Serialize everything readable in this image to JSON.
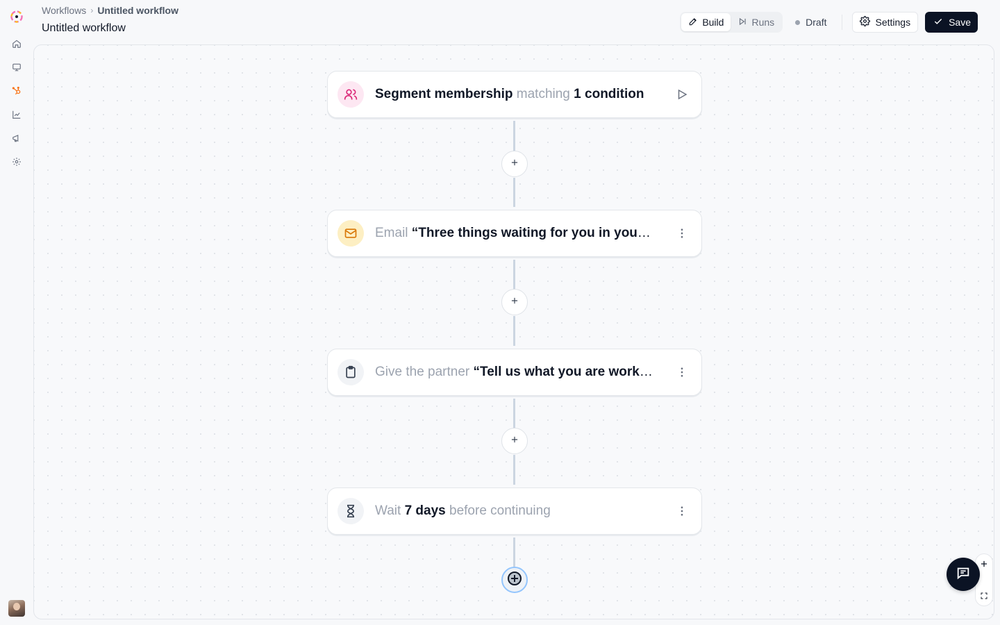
{
  "breadcrumb": {
    "root": "Workflows",
    "separator": "›",
    "current": "Untitled workflow"
  },
  "page": {
    "title": "Untitled workflow"
  },
  "toolbar": {
    "build_label": "Build",
    "runs_label": "Runs",
    "status_label": "Draft",
    "settings_label": "Settings",
    "save_label": "Save"
  },
  "nav": {
    "items": [
      "home-icon",
      "monitor-icon",
      "hubspot-icon",
      "chart-icon",
      "megaphone-icon",
      "gear-icon"
    ],
    "active": "hubspot-icon"
  },
  "workflow": {
    "trigger": {
      "title": "Segment membership",
      "connector": "matching",
      "condition": "1 condition"
    },
    "steps": [
      {
        "type": "Email",
        "value": "“Three things waiting for you in your account”"
      },
      {
        "type": "Give the partner",
        "value": "“Tell us what you are working on” form"
      },
      {
        "prefix": "Wait",
        "value": "7 days",
        "suffix": "before continuing"
      }
    ]
  },
  "colors": {
    "primary": "#0b1324",
    "accent_orange": "#f97316",
    "trigger_icon_bg": "#fde7f2",
    "trigger_icon_fg": "#db2777",
    "email_icon_bg": "#fdefc3",
    "email_icon_fg": "#d97706",
    "neutral_icon_bg": "#f1f3f6",
    "connector": "#cbd5e1"
  }
}
